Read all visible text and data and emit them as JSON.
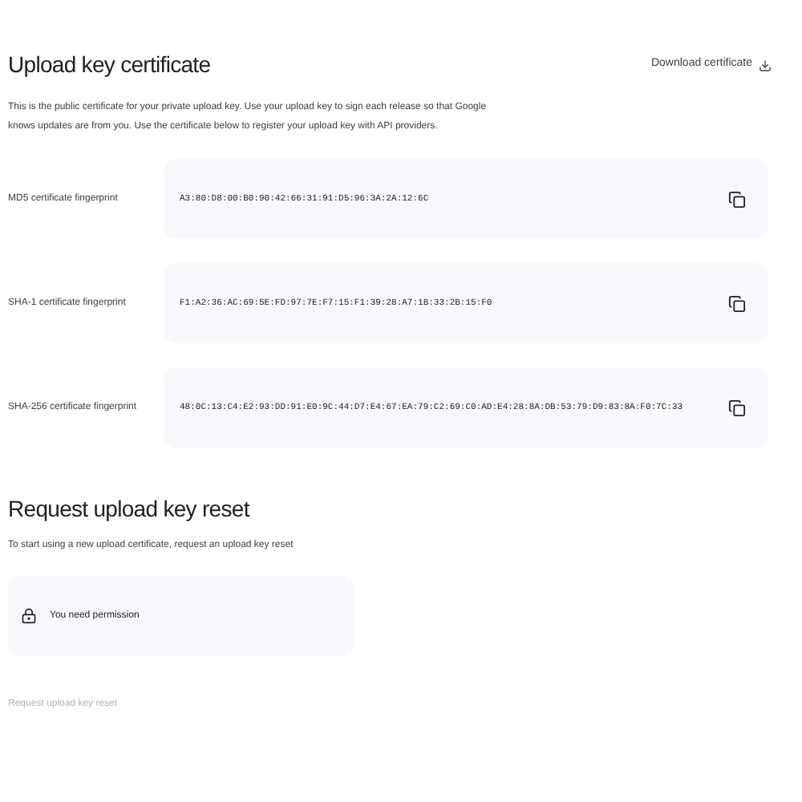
{
  "title": "Upload key certificate",
  "download_link": "Download certificate",
  "description": "This is the public certificate for your private upload key. Use your upload key to sign each release so that Google knows updates are from you. Use the certificate below to register your upload key with API providers.",
  "fingerprints": [
    {
      "label": "MD5 certificate fingerprint",
      "value": "A3:80:D8:00:B0:90:42:66:31:91:D5:96:3A:2A:12:6C"
    },
    {
      "label": "SHA-1 certificate fingerprint",
      "value": "F1:A2:36:AC:69:5E:FD:97:7E:F7:15:F1:39:28:A7:1B:33:2B:15:F0"
    },
    {
      "label": "SHA-256 certificate fingerprint",
      "value": "48:0C:13:C4:E2:93:DD:91:E0:9C:44:D7:E4:67:EA:79:C2:69:C0:AD:E4:28:8A:DB:53:79:D9:83:8A:F0:7C:33"
    }
  ],
  "reset": {
    "title": "Request upload key reset",
    "description": "To start using a new upload certificate, request an upload key reset",
    "notice": "You need permission",
    "button": {
      "label": "Request upload key reset",
      "disabled": true
    }
  }
}
